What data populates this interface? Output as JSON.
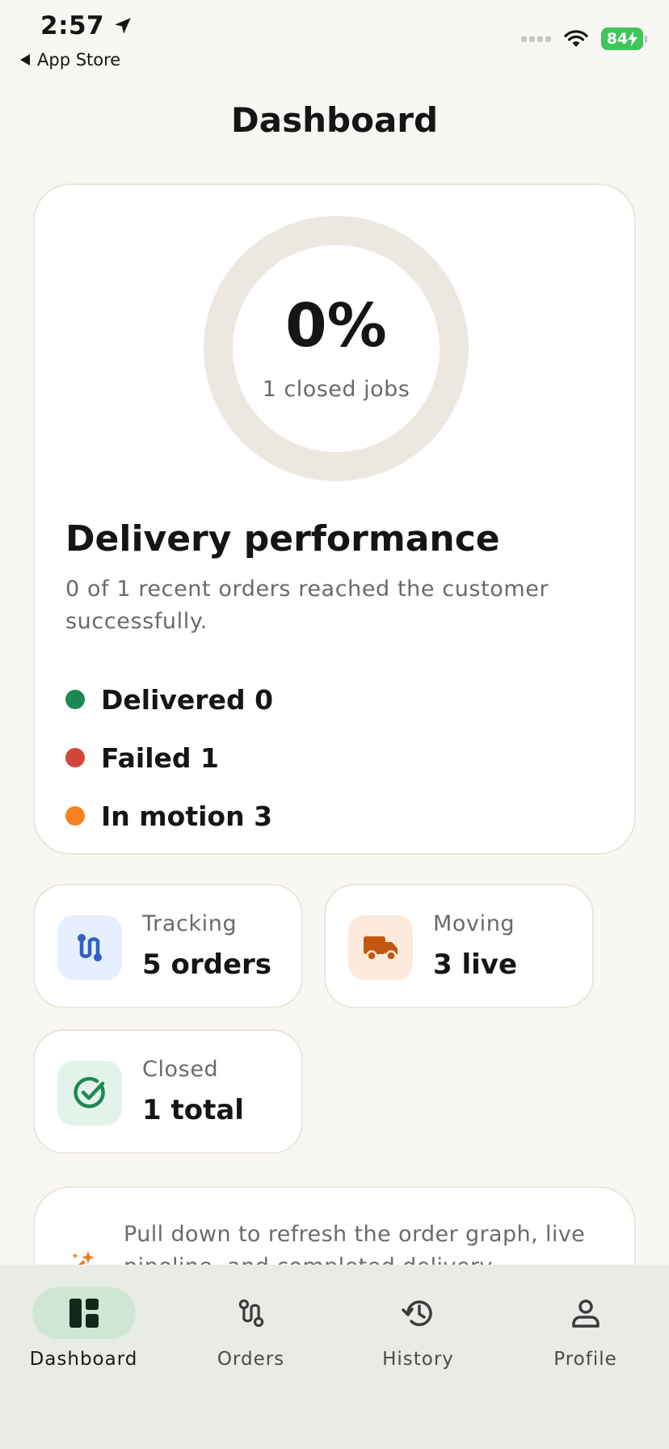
{
  "status_bar": {
    "time": "2:57",
    "back_app": "App Store",
    "battery": "84"
  },
  "header": {
    "title": "Dashboard"
  },
  "performance": {
    "percent": "0%",
    "percent_value": 0,
    "sub": "1 closed jobs",
    "title": "Delivery performance",
    "description": "0 of 1 recent orders reached the customer successfully.",
    "legend": [
      {
        "label": "Delivered",
        "value": "0",
        "color": "#1a8a52"
      },
      {
        "label": "Failed",
        "value": "1",
        "color": "#d0463a"
      },
      {
        "label": "In motion",
        "value": "3",
        "color": "#f58220"
      }
    ],
    "ring_track_color": "#ece8e1"
  },
  "stats": [
    {
      "label": "Tracking",
      "value": "5 orders",
      "icon": "route-icon",
      "icon_bg": "#e5efff",
      "icon_color": "#2f5fc8"
    },
    {
      "label": "Moving",
      "value": "3 live",
      "icon": "truck-icon",
      "icon_bg": "#fdeadc",
      "icon_color": "#c2580f"
    },
    {
      "label": "Closed",
      "value": "1 total",
      "icon": "check-circle-icon",
      "icon_bg": "#e3f3ea",
      "icon_color": "#1a8a52"
    }
  ],
  "hint": {
    "text": "Pull down to refresh the order graph, live pipeline, and completed delivery",
    "icon": "sparkle-icon",
    "icon_color": "#f07a1a"
  },
  "tabs": [
    {
      "label": "Dashboard",
      "icon": "dashboard-icon",
      "active": true
    },
    {
      "label": "Orders",
      "icon": "route-icon",
      "active": false
    },
    {
      "label": "History",
      "icon": "history-icon",
      "active": false
    },
    {
      "label": "Profile",
      "icon": "profile-icon",
      "active": false
    }
  ],
  "colors": {
    "accent": "#cfe6d5",
    "background": "#f8f7f3",
    "tabbar": "#e9ece6"
  }
}
